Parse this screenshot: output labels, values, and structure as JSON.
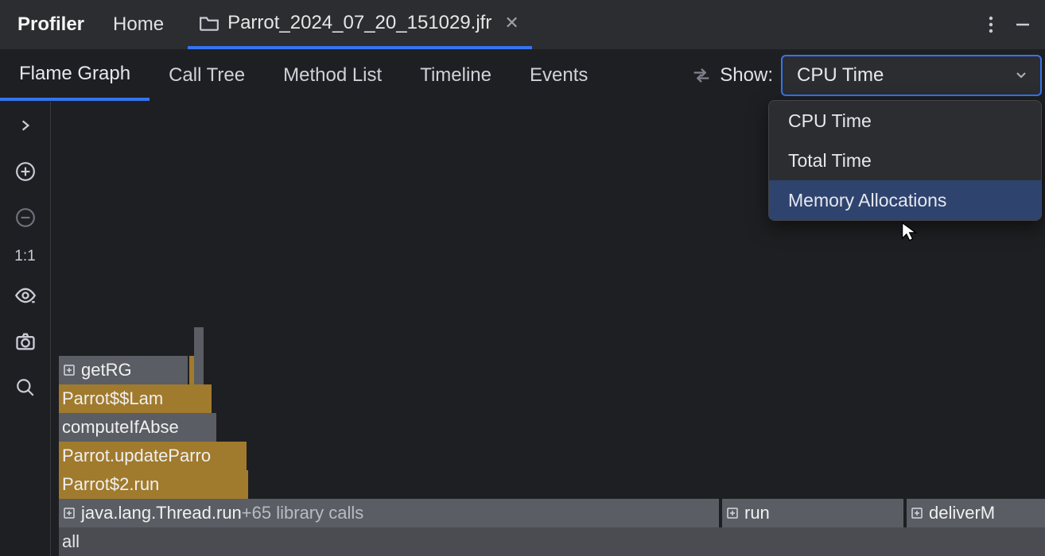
{
  "topbar": {
    "title": "Profiler",
    "home_tab": "Home",
    "file_tab_label": "Parrot_2024_07_20_151029.jfr"
  },
  "subtabs": {
    "flame": "Flame Graph",
    "calltree": "Call Tree",
    "methodlist": "Method List",
    "timeline": "Timeline",
    "events": "Events"
  },
  "dropdown": {
    "show_label": "Show:",
    "selected": "CPU Time",
    "options": [
      "CPU Time",
      "Total Time",
      "Memory Allocations"
    ]
  },
  "sidebar": {
    "ratio": "1:1"
  },
  "flame": {
    "getrg": "getRG",
    "parrot_lambda": "Parrot$$Lam",
    "compute_if_absent": "computeIfAbse",
    "update_parrot": "Parrot.updateParro",
    "parrot2_run": "Parrot$2.run",
    "thread_run": "java.lang.Thread.run",
    "thread_run_suffix": "  +65 library calls",
    "run": "run",
    "deliverm": "deliverM",
    "all": "all"
  }
}
